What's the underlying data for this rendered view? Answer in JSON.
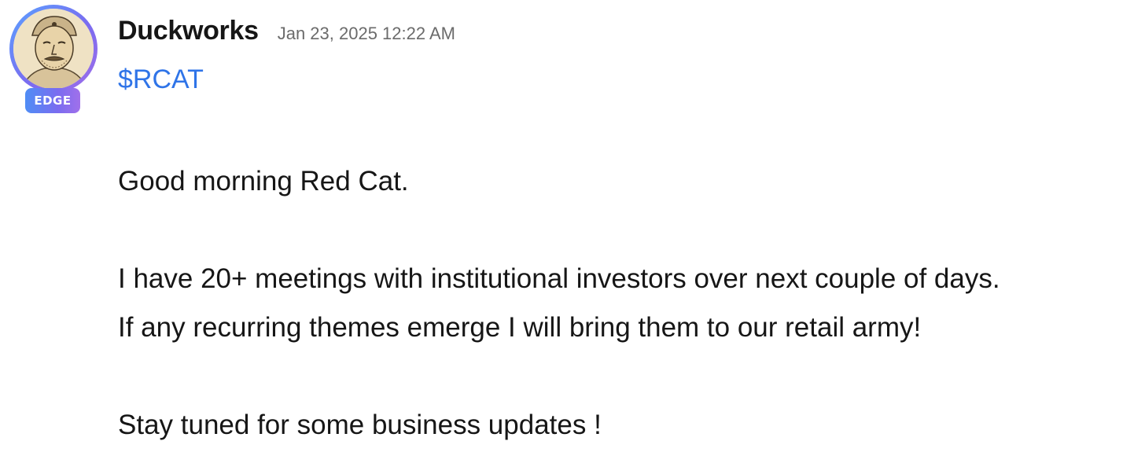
{
  "post": {
    "author": {
      "name": "Duckworks",
      "badge": "EDGE",
      "avatar_icon": "cartoon-portrait-avatar"
    },
    "timestamp": "Jan 23, 2025 12:22 AM",
    "ticker": "$RCAT",
    "body": {
      "line1": "Good morning Red Cat.",
      "line2": "I have 20+ meetings with institutional investors over next couple of days.",
      "line3": "If any recurring themes emerge I will bring them to our retail army!",
      "line4": "Stay tuned for some business updates !"
    }
  },
  "colors": {
    "ticker_link": "#2f74e8",
    "badge_gradient_start": "#4f8df5",
    "badge_gradient_end": "#a070ea",
    "timestamp_text": "#6b6b6b",
    "body_text": "#161616"
  }
}
